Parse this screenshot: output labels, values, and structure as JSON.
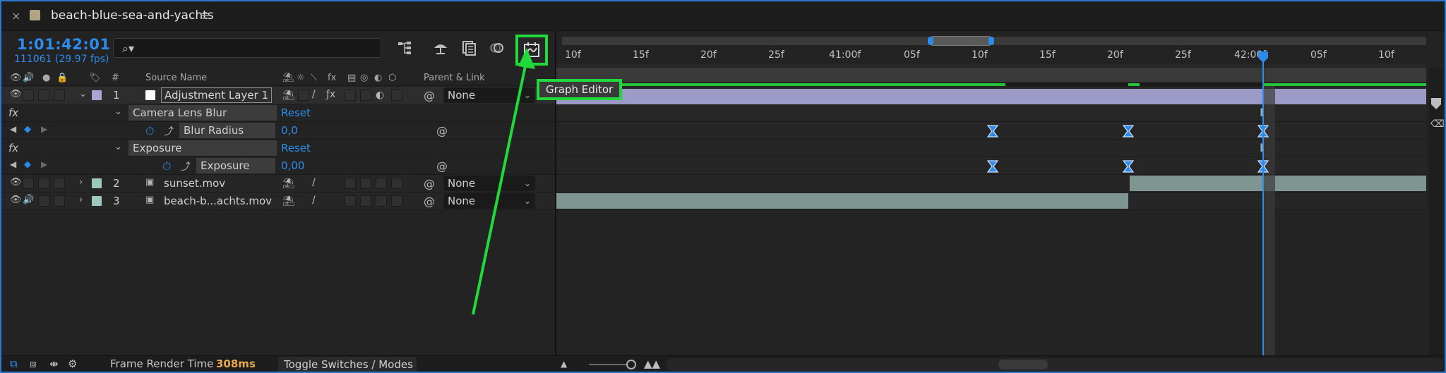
{
  "tab": {
    "title": "beach-blue-sea-and-yachts",
    "close_glyph": "×",
    "menu_glyph": "≡",
    "swatch_color": "#b2a587"
  },
  "header": {
    "timecode": "1:01:42:01",
    "frames": "111061 (29.97 fps)",
    "search_placeholder": "",
    "search_icon_glyph": "⌕▾"
  },
  "columns": {
    "hash": "#",
    "source_name": "Source Name",
    "parent_link": "Parent & Link",
    "fx": "fx"
  },
  "layers": [
    {
      "index": "1",
      "name": "Adjustment Layer 1",
      "parent": "None",
      "swatch": "#a9a4d2"
    },
    {
      "index": "2",
      "name": "sunset.mov",
      "parent": "None",
      "swatch": "#9cc8c0"
    },
    {
      "index": "3",
      "name": "beach-b...achts.mov",
      "parent": "None",
      "swatch": "#9cc8c0"
    }
  ],
  "effects": [
    {
      "fx_label": "fx",
      "name": "Camera Lens Blur",
      "reset": "Reset",
      "property": "Blur Radius",
      "value": "0,0"
    },
    {
      "fx_label": "fx",
      "name": "Exposure",
      "reset": "Reset",
      "property": "Exposure",
      "value": "0,00"
    }
  ],
  "timeline": {
    "ticks": [
      "10f",
      "15f",
      "20f",
      "25f",
      "41:00f",
      "05f",
      "10f",
      "15f",
      "20f",
      "25f",
      "42:00f",
      "05f",
      "10f"
    ]
  },
  "tooltip": "Graph Editor",
  "bottom": {
    "frame_render_label": "Frame Render Time",
    "frame_render_value": "308ms",
    "toggle_label": "Toggle Switches / Modes"
  },
  "colors": {
    "accent_blue": "#2d8ceb",
    "highlight_green": "#21d93a",
    "adjustment_bar": "#9c9ac6",
    "footage_bar": "#7f9591",
    "render_value": "#e8a84a"
  }
}
